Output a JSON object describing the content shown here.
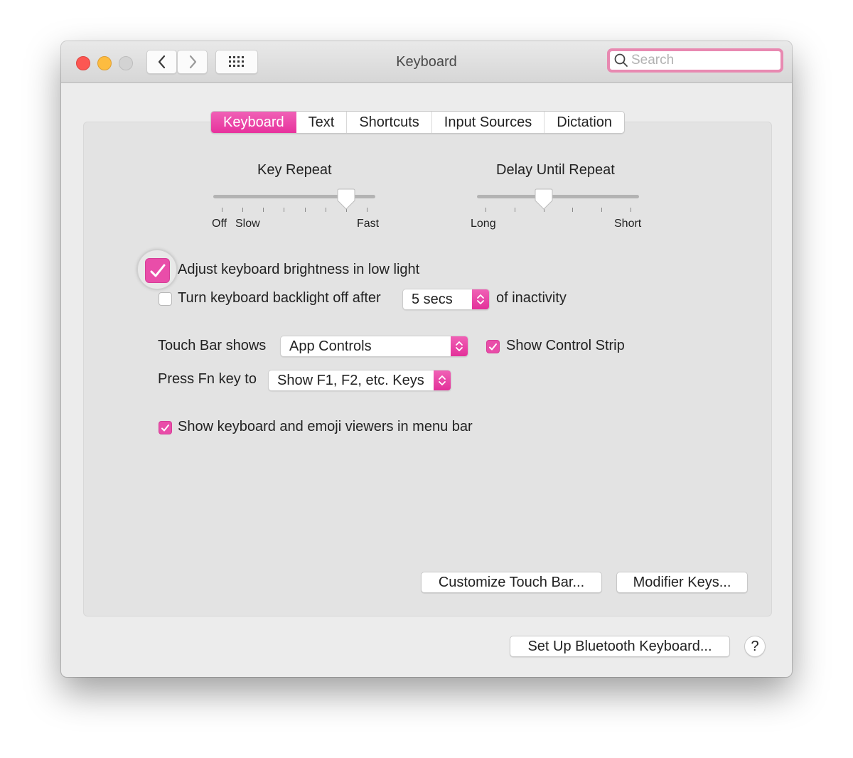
{
  "window": {
    "title": "Keyboard",
    "search": {
      "placeholder": "Search",
      "value": ""
    }
  },
  "toolbar": {
    "back_icon": "chevron-left",
    "forward_icon": "chevron-right",
    "show_all_icon": "grid-dots"
  },
  "tabs": [
    {
      "label": "Keyboard",
      "active": true
    },
    {
      "label": "Text",
      "active": false
    },
    {
      "label": "Shortcuts",
      "active": false
    },
    {
      "label": "Input Sources",
      "active": false
    },
    {
      "label": "Dictation",
      "active": false
    }
  ],
  "sliders": {
    "key_repeat": {
      "title": "Key Repeat",
      "labels": {
        "off": "Off",
        "slow": "Slow",
        "fast": "Fast"
      },
      "tick_count": 8,
      "value_index": 6
    },
    "delay_until_repeat": {
      "title": "Delay Until Repeat",
      "labels": {
        "long": "Long",
        "short": "Short"
      },
      "tick_count": 6,
      "value_index": 2
    }
  },
  "options": {
    "adjust_brightness": {
      "label": "Adjust keyboard brightness in low light",
      "checked": true
    },
    "backlight_off": {
      "label": "Turn keyboard backlight off after",
      "checked": false,
      "popup_value": "5 secs",
      "suffix": "of inactivity"
    },
    "touch_bar": {
      "label": "Touch Bar shows",
      "popup_value": "App Controls"
    },
    "control_strip": {
      "label": "Show Control Strip",
      "checked": true
    },
    "fn_key": {
      "label": "Press Fn key to",
      "popup_value": "Show F1, F2, etc. Keys"
    },
    "emoji_viewers": {
      "label": "Show keyboard and emoji viewers in menu bar",
      "checked": true
    }
  },
  "buttons": {
    "customize_touch_bar": "Customize Touch Bar...",
    "modifier_keys": "Modifier Keys...",
    "bluetooth": "Set Up Bluetooth Keyboard...",
    "help": "?"
  },
  "colors": {
    "accent": "#e94da9",
    "search_focus_ring": "#e889b1",
    "close": "#fc5753",
    "minimize": "#fdbc40",
    "zoom_disabled": "#d3d3d3"
  }
}
